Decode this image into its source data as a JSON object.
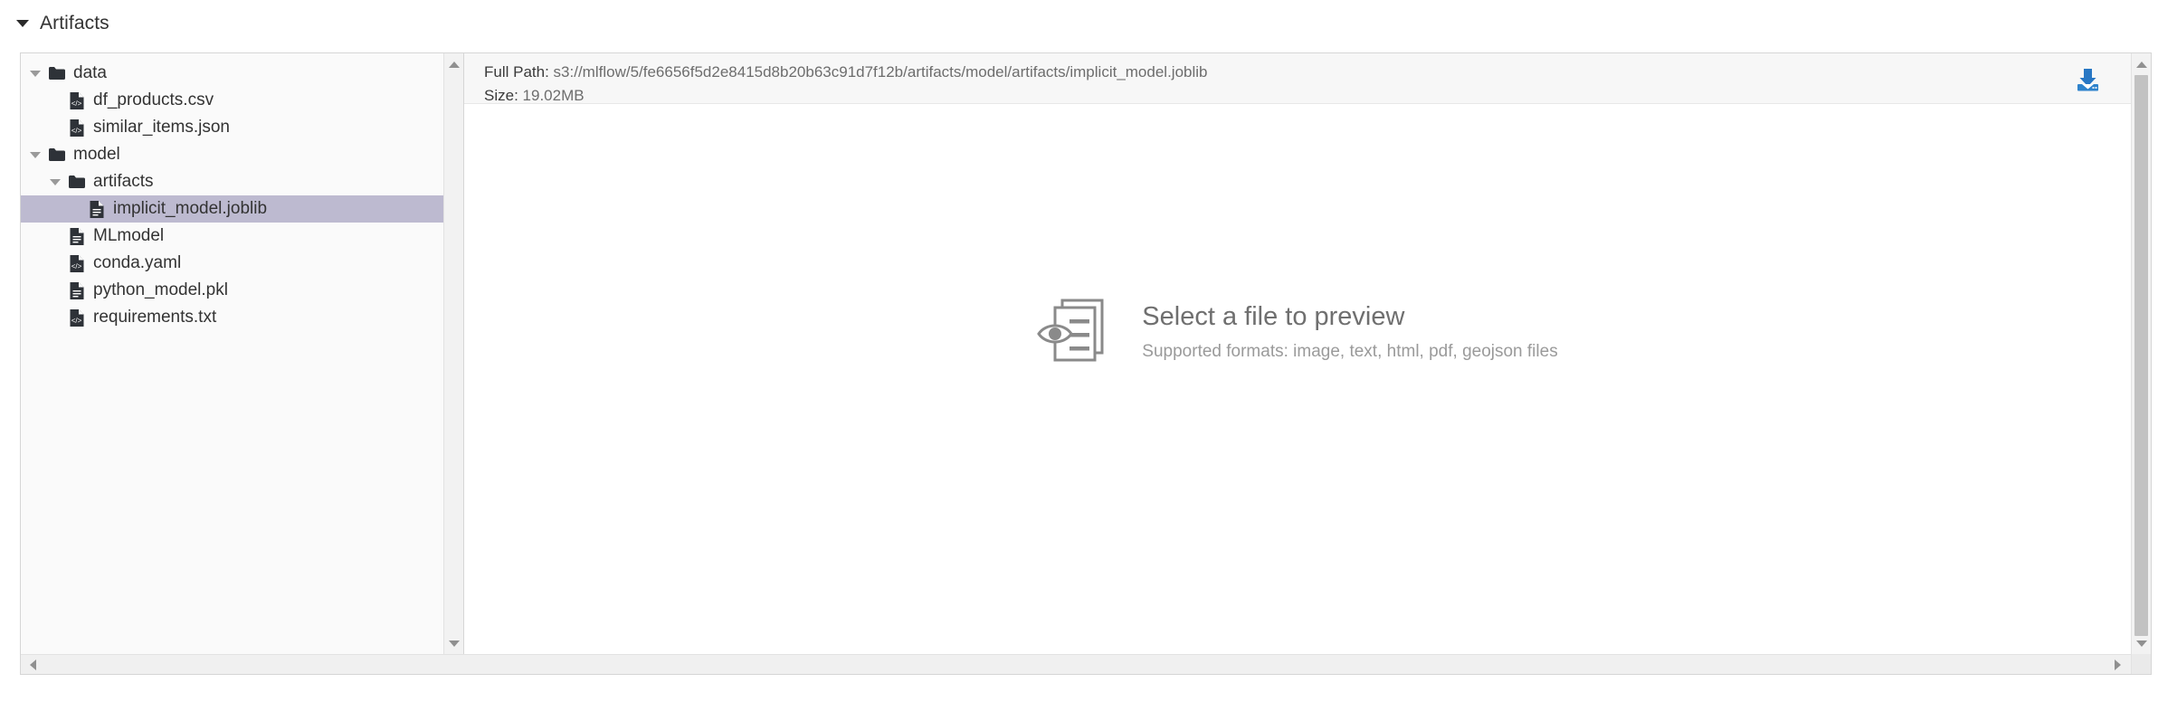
{
  "section": {
    "title": "Artifacts",
    "expanded": true,
    "caret_icon": "caret-down-icon"
  },
  "tree": {
    "items": [
      {
        "label": "data",
        "type": "folder",
        "depth": 0,
        "expanded": true,
        "icon": "folder-icon",
        "caret": "caret-down-icon",
        "selected": false
      },
      {
        "label": "df_products.csv",
        "type": "file",
        "depth": 1,
        "expanded": null,
        "icon": "code-file-icon",
        "caret": "",
        "selected": false
      },
      {
        "label": "similar_items.json",
        "type": "file",
        "depth": 1,
        "expanded": null,
        "icon": "code-file-icon",
        "caret": "",
        "selected": false
      },
      {
        "label": "model",
        "type": "folder",
        "depth": 0,
        "expanded": true,
        "icon": "folder-icon",
        "caret": "caret-down-icon",
        "selected": false
      },
      {
        "label": "artifacts",
        "type": "folder",
        "depth": 1,
        "expanded": true,
        "icon": "folder-icon",
        "caret": "caret-down-icon",
        "selected": false
      },
      {
        "label": "implicit_model.joblib",
        "type": "file",
        "depth": 2,
        "expanded": null,
        "icon": "text-file-icon",
        "caret": "",
        "selected": true
      },
      {
        "label": "MLmodel",
        "type": "file",
        "depth": 1,
        "expanded": null,
        "icon": "text-file-icon",
        "caret": "",
        "selected": false
      },
      {
        "label": "conda.yaml",
        "type": "file",
        "depth": 1,
        "expanded": null,
        "icon": "code-file-icon",
        "caret": "",
        "selected": false
      },
      {
        "label": "python_model.pkl",
        "type": "file",
        "depth": 1,
        "expanded": null,
        "icon": "text-file-icon",
        "caret": "",
        "selected": false
      },
      {
        "label": "requirements.txt",
        "type": "file",
        "depth": 1,
        "expanded": null,
        "icon": "code-file-icon",
        "caret": "",
        "selected": false
      }
    ],
    "scrollbar": {
      "up_icon": "scroll-up-arrow-icon",
      "down_icon": "scroll-down-arrow-icon"
    }
  },
  "preview": {
    "full_path_label": "Full Path:",
    "full_path_value": "s3://mlflow/5/fe6656f5d2e8415d8b20b63c91d7f12b/artifacts/model/artifacts/implicit_model.joblib",
    "size_label": "Size:",
    "size_value": "19.02MB",
    "download_icon": "download-icon",
    "download_color": "#2877c4",
    "empty_state": {
      "icon": "file-preview-icon",
      "title": "Select a file to preview",
      "subtitle": "Supported formats: image, text, html, pdf, geojson files"
    },
    "scrollbar": {
      "up_icon": "scroll-up-arrow-icon",
      "down_icon": "scroll-down-arrow-icon"
    }
  },
  "horizontal_scrollbar": {
    "left_icon": "scroll-left-arrow-icon",
    "right_icon": "scroll-right-arrow-icon"
  },
  "colors": {
    "selected_row": "#bdbad0",
    "panel_border": "#d6d6d6",
    "tree_bg": "#fafafa",
    "header_bg": "#f7f7f7"
  }
}
